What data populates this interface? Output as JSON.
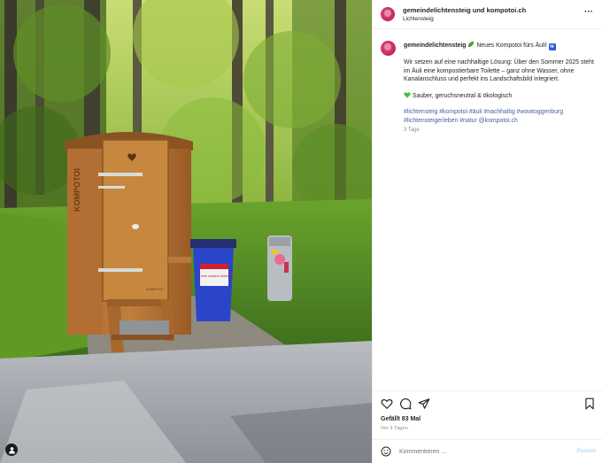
{
  "header": {
    "account": "gemeindelichtensteig und kompotoi.ch",
    "location": "Lichtensteig",
    "more_label": "···"
  },
  "caption": {
    "username": "gemeindelichtensteig",
    "headline": "Neues Kompotoi fürs Äuli!",
    "body": "Wir setzen auf eine nachhaltige Lösung: Über den Sommer 2025 steht im Äuli eine kompostierbare Toilette – ganz ohne Wasser, ohne Kanalanschluss und perfekt ins Landschaftsbild integriert.",
    "features": "Sauber, geruchsneutral & ökologisch",
    "hashtags": "#lichtensteig #kompotoi #äuli #nachhaltig #wowtoggenburg #lichtensteigerleben #natur @kompotoi.ch",
    "age": "3 Tage"
  },
  "photo": {
    "toilet_label": "KOMPOTOI",
    "bin_sign": "Für eine saubere Äulinatur",
    "door_small_label": "KOMPOTOI"
  },
  "engagement": {
    "likes": "Gefällt 83 Mal",
    "date": "Vor 3 Tagen"
  },
  "comment": {
    "placeholder": "Kommentieren ...",
    "post_label": "Posten"
  },
  "icons": {
    "like": "heart-icon",
    "comment": "comment-icon",
    "share": "share-icon",
    "save": "bookmark-icon",
    "emoji": "emoji-icon",
    "more": "more-icon",
    "user_tag": "user-tag-icon"
  },
  "colors": {
    "hashtag": "#4a5fa8",
    "avatar": "#c8275a",
    "post_disabled": "#b3dbff"
  }
}
